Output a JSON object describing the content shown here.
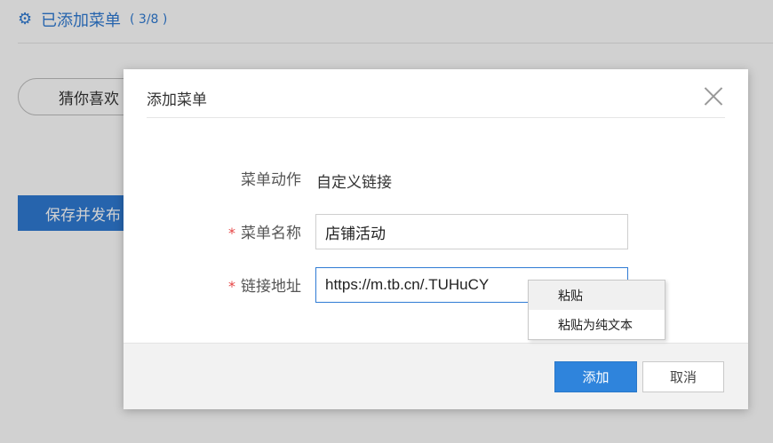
{
  "page": {
    "header_title": "已添加菜单",
    "header_count": "( 3/8 )",
    "menu_item": "猜你喜欢",
    "save_publish": "保存并发布"
  },
  "dialog": {
    "title": "添加菜单",
    "action_label": "菜单动作",
    "action_value": "自定义链接",
    "required_mark": "*",
    "name_label": "菜单名称",
    "name_value": "店铺活动",
    "link_label": "链接地址",
    "link_value": "https://m.tb.cn/.TUHuCY",
    "add_button": "添加",
    "cancel_button": "取消"
  },
  "context_menu": {
    "items": [
      "粘贴",
      "粘贴为纯文本"
    ]
  },
  "colors": {
    "accent": "#2f7bd4",
    "required": "#e64545"
  }
}
